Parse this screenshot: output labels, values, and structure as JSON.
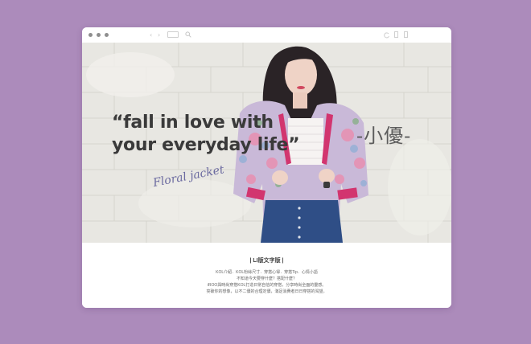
{
  "browser": {
    "back_icon": "chevron-left-icon",
    "forward_icon": "chevron-right-icon",
    "search_icon": "search-icon"
  },
  "hero": {
    "quote": "“fall in love with\nyour everyday life”",
    "signature": "-小優-",
    "handwritten_note": "Floral jacket"
  },
  "caption": {
    "title": "| LI版文字版 |",
    "lines": [
      "KOL介紹．KOL粉絲尺寸．穿搭心得．穿搭Tip．心情小語",
      "不知道今天要穿什麼？搭配什麼？",
      "iROO與時尚穿搭KOL打造日常自信的穿搭，分享時尚全面的靈感。",
      "突破你的想像，以不二價的合理定價，滿足消費者日日穿搭的渴望。"
    ]
  },
  "colors": {
    "page_background": "#ac8bbb",
    "jacket_accent": "#d2356f"
  }
}
